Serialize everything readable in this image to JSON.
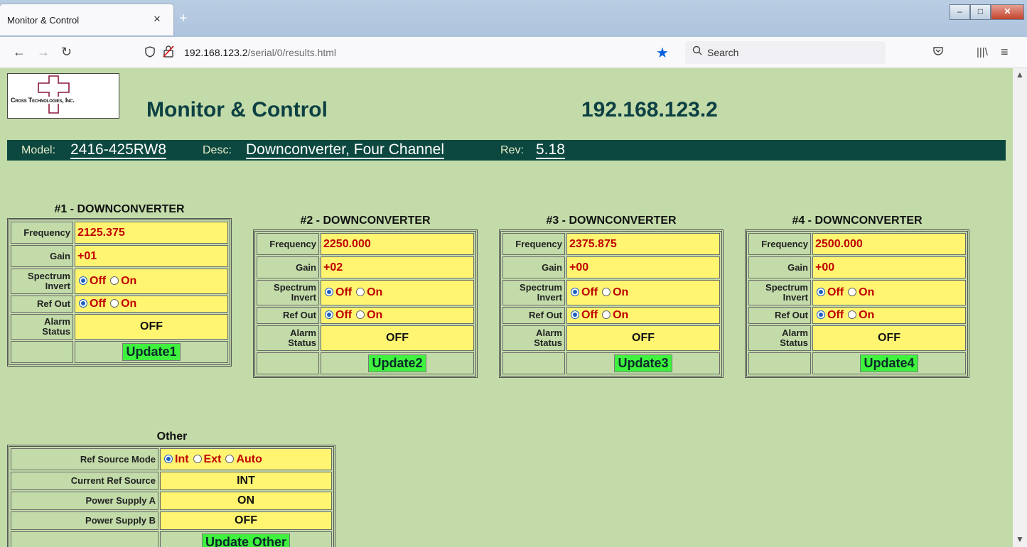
{
  "browser": {
    "tab_title": "Monitor & Control",
    "tab_close": "×",
    "new_tab": "+",
    "url_host": "192.168.123.2",
    "url_path": "/serial/0/results.html",
    "search_placeholder": "Search"
  },
  "header": {
    "logo_text": "Cross Technologies, Inc.",
    "title": "Monitor & Control",
    "ip": "192.168.123.2"
  },
  "info": {
    "model_label": "Model:",
    "model": "2416-425RW8",
    "desc_label": "Desc:",
    "desc": "Downconverter, Four Channel",
    "rev_label": "Rev:",
    "rev": "5.18"
  },
  "labels": {
    "frequency": "Frequency",
    "gain": "Gain",
    "spectrum_invert": "Spectrum Invert",
    "ref_out": "Ref Out",
    "alarm_status": "Alarm Status",
    "off": "Off",
    "on": "On"
  },
  "converters": [
    {
      "title": "#1 - DOWNCONVERTER",
      "frequency": "2125.375",
      "gain": "+01",
      "spectrum_invert": "Off",
      "ref_out": "Off",
      "alarm": "OFF",
      "button": "Update1"
    },
    {
      "title": "#2 - DOWNCONVERTER",
      "frequency": "2250.000",
      "gain": "+02",
      "spectrum_invert": "Off",
      "ref_out": "Off",
      "alarm": "OFF",
      "button": "Update2"
    },
    {
      "title": "#3 - DOWNCONVERTER",
      "frequency": "2375.875",
      "gain": "+00",
      "spectrum_invert": "Off",
      "ref_out": "Off",
      "alarm": "OFF",
      "button": "Update3"
    },
    {
      "title": "#4 - DOWNCONVERTER",
      "frequency": "2500.000",
      "gain": "+00",
      "spectrum_invert": "Off",
      "ref_out": "Off",
      "alarm": "OFF",
      "button": "Update4"
    }
  ],
  "other": {
    "title": "Other",
    "ref_source_mode_label": "Ref Source Mode",
    "ref_source_options": [
      "Int",
      "Ext",
      "Auto"
    ],
    "ref_source_selected": "Int",
    "current_ref_source_label": "Current Ref Source",
    "current_ref_source": "INT",
    "power_a_label": "Power Supply A",
    "power_a": "ON",
    "power_b_label": "Power Supply B",
    "power_b": "OFF",
    "button": "Update Other"
  },
  "colors": {
    "page_bg": "#c2dba9",
    "info_bar": "#0c4840",
    "value_bg": "#fff571",
    "value_text": "#c00000",
    "button_bg": "#3ef23e"
  },
  "icons": [
    "back-arrow-icon",
    "forward-arrow-icon",
    "reload-icon",
    "shield-icon",
    "insecure-lock-icon",
    "bookmark-star-icon",
    "search-icon",
    "pocket-icon",
    "library-icon",
    "menu-icon"
  ]
}
